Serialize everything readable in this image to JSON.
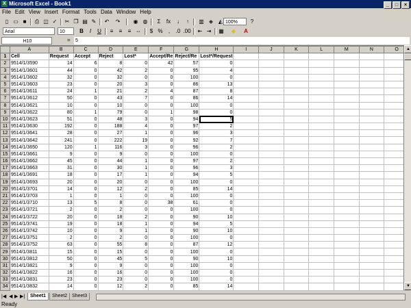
{
  "window": {
    "title": "Microsoft Excel - Book1"
  },
  "menu": [
    "File",
    "Edit",
    "View",
    "Insert",
    "Format",
    "Tools",
    "Data",
    "Window",
    "Help"
  ],
  "toolbar": {
    "font": "Arial",
    "size": "10",
    "zoom": "100%",
    "bold": "B",
    "italic": "I",
    "underline": "U",
    "currency": "$",
    "percent": "%",
    "comma": ","
  },
  "formula_bar": {
    "name_box": "H10",
    "equals": "=",
    "value": "5"
  },
  "columns": [
    "A",
    "B",
    "C",
    "D",
    "E",
    "F",
    "G",
    "H",
    "I",
    "J",
    "K",
    "L",
    "M",
    "N",
    "O"
  ],
  "headers": [
    "Cell",
    "Request",
    "Accept",
    "Reject",
    "Lost*",
    "Accept/Re",
    "Reject/Re",
    "Lost*/Request"
  ],
  "rows": [
    [
      "9514/1/3590",
      "14",
      "6",
      "8",
      "0",
      "42",
      "57",
      "0"
    ],
    [
      "9514/1/3601",
      "44",
      "0",
      "42",
      "2",
      "0",
      "95",
      "4"
    ],
    [
      "9514/1/3602",
      "32",
      "0",
      "32",
      "0",
      "0",
      "100",
      "0"
    ],
    [
      "9514/1/3603",
      "23",
      "0",
      "20",
      "3",
      "0",
      "86",
      "13"
    ],
    [
      "9514/1/3611",
      "24",
      "1",
      "21",
      "2",
      "4",
      "87",
      "8"
    ],
    [
      "9514/1/3612",
      "50",
      "0",
      "43",
      "7",
      "0",
      "86",
      "14"
    ],
    [
      "9514/1/3621",
      "10",
      "0",
      "10",
      "0",
      "0",
      "100",
      "0"
    ],
    [
      "9514/1/3622",
      "80",
      "1",
      "79",
      "0",
      "1",
      "98",
      "0"
    ],
    [
      "9514/1/3623",
      "51",
      "0",
      "48",
      "3",
      "0",
      "94",
      "5"
    ],
    [
      "9514/1/3630",
      "192",
      "0",
      "188",
      "4",
      "0",
      "97",
      "2"
    ],
    [
      "9514/1/3641",
      "28",
      "0",
      "27",
      "1",
      "0",
      "96",
      "3"
    ],
    [
      "9514/1/3642",
      "241",
      "0",
      "222",
      "19",
      "0",
      "92",
      "7"
    ],
    [
      "9514/1/3650",
      "120",
      "1",
      "116",
      "3",
      "0",
      "96",
      "2"
    ],
    [
      "9514/1/3661",
      "9",
      "0",
      "9",
      "0",
      "0",
      "100",
      "0"
    ],
    [
      "9514/1/3662",
      "45",
      "0",
      "44",
      "1",
      "0",
      "97",
      "2"
    ],
    [
      "9514/1/3663",
      "31",
      "0",
      "30",
      "1",
      "0",
      "96",
      "3"
    ],
    [
      "9514/1/3691",
      "18",
      "0",
      "17",
      "1",
      "0",
      "94",
      "5"
    ],
    [
      "9514/1/3693",
      "20",
      "0",
      "20",
      "0",
      "0",
      "100",
      "0"
    ],
    [
      "9514/1/3701",
      "14",
      "0",
      "12",
      "2",
      "0",
      "85",
      "14"
    ],
    [
      "9514/1/3703",
      "1",
      "0",
      "1",
      "0",
      "0",
      "100",
      "0"
    ],
    [
      "9514/1/3710",
      "13",
      "5",
      "8",
      "0",
      "38",
      "61",
      "0"
    ],
    [
      "9514/1/3721",
      "2",
      "0",
      "2",
      "0",
      "0",
      "100",
      "0"
    ],
    [
      "9514/1/3722",
      "20",
      "0",
      "18",
      "2",
      "0",
      "90",
      "10"
    ],
    [
      "9514/1/3741",
      "19",
      "0",
      "18",
      "1",
      "0",
      "94",
      "5"
    ],
    [
      "9514/1/3742",
      "10",
      "0",
      "9",
      "1",
      "0",
      "90",
      "10"
    ],
    [
      "9514/1/3751",
      "2",
      "0",
      "2",
      "0",
      "0",
      "100",
      "0"
    ],
    [
      "9514/1/3752",
      "63",
      "0",
      "55",
      "8",
      "0",
      "87",
      "12"
    ],
    [
      "9514/1/3811",
      "15",
      "0",
      "15",
      "0",
      "0",
      "100",
      "0"
    ],
    [
      "9514/1/3812",
      "50",
      "0",
      "45",
      "5",
      "0",
      "90",
      "10"
    ],
    [
      "9514/1/3821",
      "9",
      "0",
      "9",
      "0",
      "0",
      "100",
      "0"
    ],
    [
      "9514/1/3822",
      "16",
      "0",
      "16",
      "0",
      "0",
      "100",
      "0"
    ],
    [
      "9514/1/3831",
      "23",
      "0",
      "23",
      "0",
      "0",
      "100",
      "0"
    ],
    [
      "9514/1/3832",
      "14",
      "0",
      "12",
      "2",
      "0",
      "85",
      "14"
    ],
    [
      "9514/1/3833",
      "12",
      "0",
      "8",
      "4",
      "0",
      "66",
      "33"
    ]
  ],
  "sheets": [
    "Sheet1",
    "Sheet2",
    "Sheet3"
  ],
  "status": "Ready"
}
